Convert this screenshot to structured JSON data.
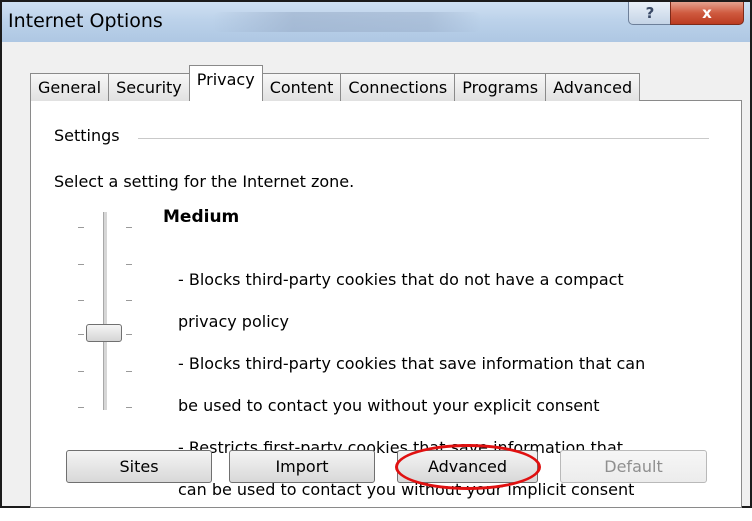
{
  "window": {
    "title": "Internet Options",
    "help_glyph": "?",
    "close_glyph": "x"
  },
  "tabs": [
    {
      "label": "General",
      "active": false
    },
    {
      "label": "Security",
      "active": false
    },
    {
      "label": "Privacy",
      "active": true
    },
    {
      "label": "Content",
      "active": false
    },
    {
      "label": "Connections",
      "active": false
    },
    {
      "label": "Programs",
      "active": false
    },
    {
      "label": "Advanced",
      "active": false
    }
  ],
  "settings": {
    "group_label": "Settings",
    "zone_text": "Select a setting for the Internet zone.",
    "slider": {
      "level_title": "Medium",
      "position_index": 3,
      "levels": 6
    },
    "description_lines": [
      "- Blocks third-party cookies that do not have a compact",
      "privacy policy",
      "- Blocks third-party cookies that save information that can",
      "be used to contact you without your explicit consent",
      "- Restricts first-party cookies that save information that",
      "can be used to contact you without your implicit consent"
    ]
  },
  "buttons": {
    "sites": "Sites",
    "import": "Import",
    "advanced": "Advanced",
    "default": "Default"
  },
  "colors": {
    "annotation": "#e01010",
    "close_button": "#c84a2f",
    "titlebar": "#bcd2ea"
  }
}
